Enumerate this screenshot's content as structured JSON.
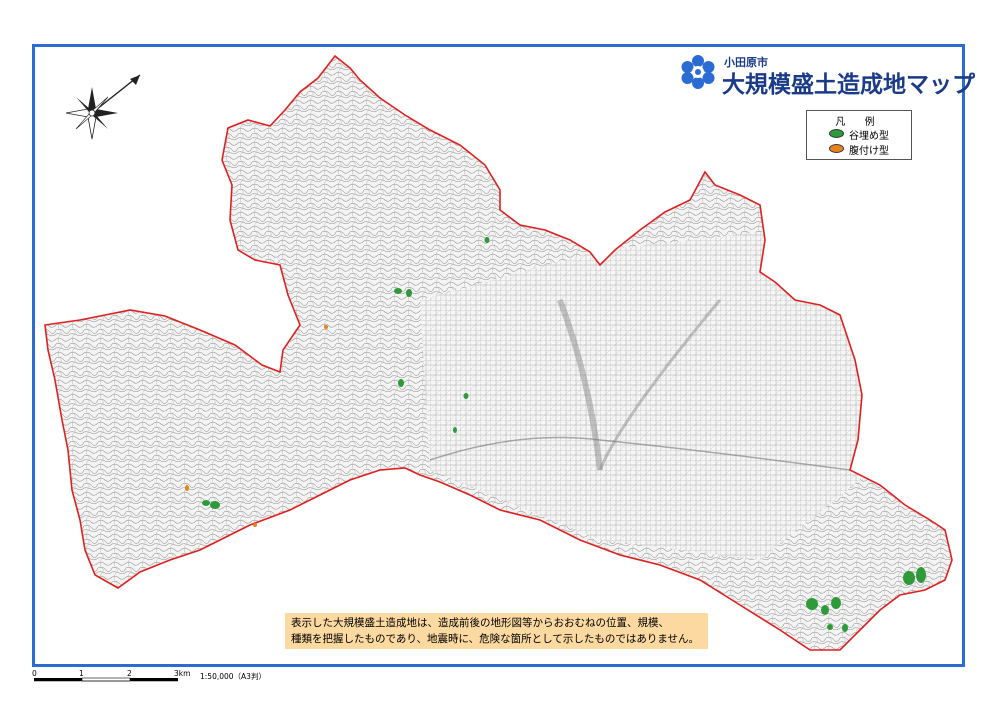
{
  "header": {
    "city": "小田原市",
    "title": "大規模盛土造成地マップ"
  },
  "legend": {
    "title": "凡 例",
    "items": [
      {
        "label": "谷埋め型",
        "color": "#2e9a3a"
      },
      {
        "label": "腹付け型",
        "color": "#e8821e"
      }
    ]
  },
  "notice": {
    "line1": "表示した大規模盛土造成地は、造成前後の地形図等からおおむねの位置、規模、",
    "line2": "種類を把握したものであり、地震時に、危険な箇所として示したものではありません。"
  },
  "scale": {
    "ticks": [
      "0",
      "1",
      "2",
      "3km"
    ],
    "ratio": "1:50,000（A3判）"
  },
  "colors": {
    "frame": "#2b6cd4",
    "boundary": "#e02020",
    "title": "#1a3a8a",
    "notice_bg": "#fbd9a0"
  },
  "icons": [
    "compass-rose-icon",
    "city-emblem-icon"
  ]
}
